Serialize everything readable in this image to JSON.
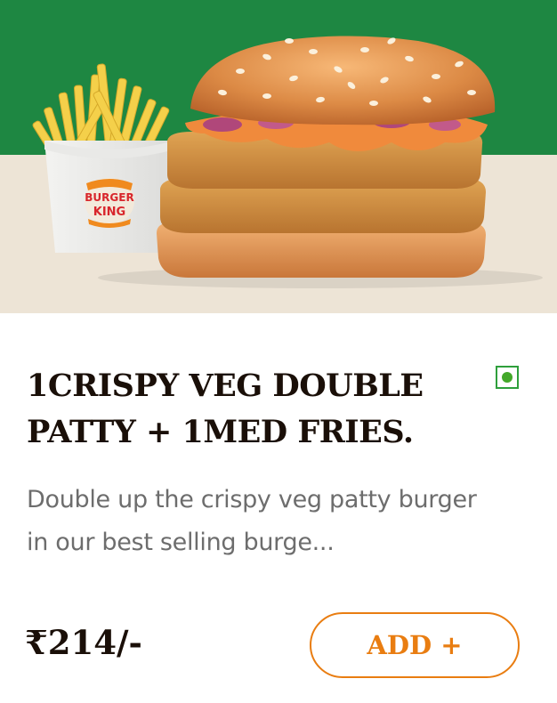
{
  "product": {
    "image": {
      "alt": "Crispy veg double patty burger with medium fries",
      "bg_top_color": "#1e8742",
      "bg_bottom_color": "#ede4d6",
      "fries_box_text": [
        "BURGER",
        "KING"
      ]
    },
    "title": "1CRISPY VEG DOUBLE PATTY + 1MED FRIES.",
    "veg_indicator": {
      "icon": "veg-indicator-icon",
      "color": "#43a82a"
    },
    "description": "Double up the crispy veg patty burger in our best selling burge...",
    "price": "₹214/-",
    "add_button_label": "ADD +",
    "accent_color": "#e97d11"
  }
}
